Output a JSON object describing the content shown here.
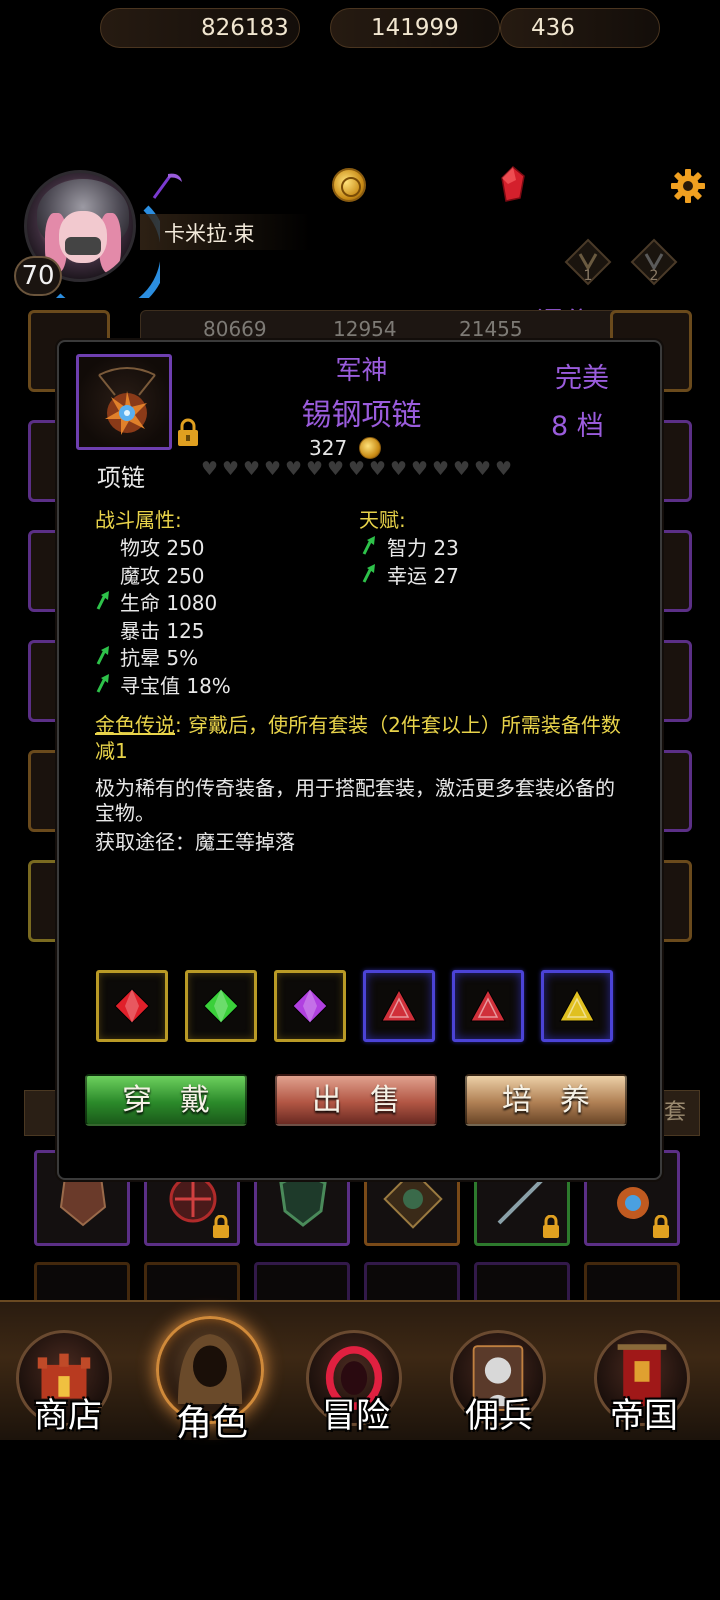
{
  "hud": {
    "exp": "826183",
    "gold": "141999",
    "gems": "436",
    "player_name": "卡米拉·束",
    "level": "70",
    "score": "评分:1503",
    "tab1": "1",
    "tab2": "2",
    "icons": {
      "exp": "purple-scythe-icon",
      "gold": "gold-coin-icon",
      "gem": "red-crystal-icon",
      "settings": "gear-icon"
    },
    "colors": {
      "gold": "#c88a14",
      "gem": "#d4202c",
      "gear": "#f0a020",
      "purple": "#9a5cdc"
    }
  },
  "background_stats": [
    "80669",
    "12954",
    "21455"
  ],
  "item": {
    "prefix": "军神",
    "name": "锡钢项链",
    "price": "327",
    "quality": "完美",
    "grade": "8 档",
    "slot_type": "项链",
    "hearts_total": 15,
    "hearts_filled": 0,
    "locked": true,
    "combat_title": "战斗属性:",
    "combat_stats": [
      {
        "text": "物攻 250",
        "up": false
      },
      {
        "text": "魔攻 250",
        "up": false
      },
      {
        "text": "生命 1080",
        "up": true
      },
      {
        "text": "暴击 125",
        "up": false
      },
      {
        "text": "抗晕 5%",
        "up": true
      },
      {
        "text": "寻宝值 18%",
        "up": true
      }
    ],
    "talent_title": "天赋:",
    "talents": [
      {
        "text": "智力 23",
        "up": true
      },
      {
        "text": "幸运 27",
        "up": true
      }
    ],
    "legend_label": "金色传说",
    "legend_text": ": 穿戴后，使所有套装（2件套以上）所需装备件数减1",
    "description": "极为稀有的传奇装备，用于搭配套装，激活更多套装必备的宝物。",
    "source": "获取途径：魔王等掉落",
    "gem_slots": [
      {
        "frame": "gold",
        "gem": "red-diamond-gem-icon",
        "color": "#e0202a"
      },
      {
        "frame": "gold",
        "gem": "green-diamond-gem-icon",
        "color": "#3ad03a"
      },
      {
        "frame": "gold",
        "gem": "purple-diamond-gem-icon",
        "color": "#b040e0"
      },
      {
        "frame": "blue",
        "gem": "red-triangle-gem-icon",
        "color": "#d0303a"
      },
      {
        "frame": "blue",
        "gem": "red-triangle-gem-icon",
        "color": "#d0303a"
      },
      {
        "frame": "blue",
        "gem": "yellow-triangle-gem-icon",
        "color": "#e0c020"
      }
    ]
  },
  "buttons": {
    "equip": "穿戴",
    "sell": "出售",
    "train": "培养"
  },
  "side_tab_right": "套",
  "nav": [
    {
      "label": "商店",
      "icon": "castle-icon",
      "active": false
    },
    {
      "label": "角色",
      "icon": "hooded-figure-icon",
      "active": true
    },
    {
      "label": "冒险",
      "icon": "red-portal-icon",
      "active": false
    },
    {
      "label": "佣兵",
      "icon": "mercenary-card-icon",
      "active": false
    },
    {
      "label": "帝国",
      "icon": "banner-icon",
      "active": false
    }
  ]
}
